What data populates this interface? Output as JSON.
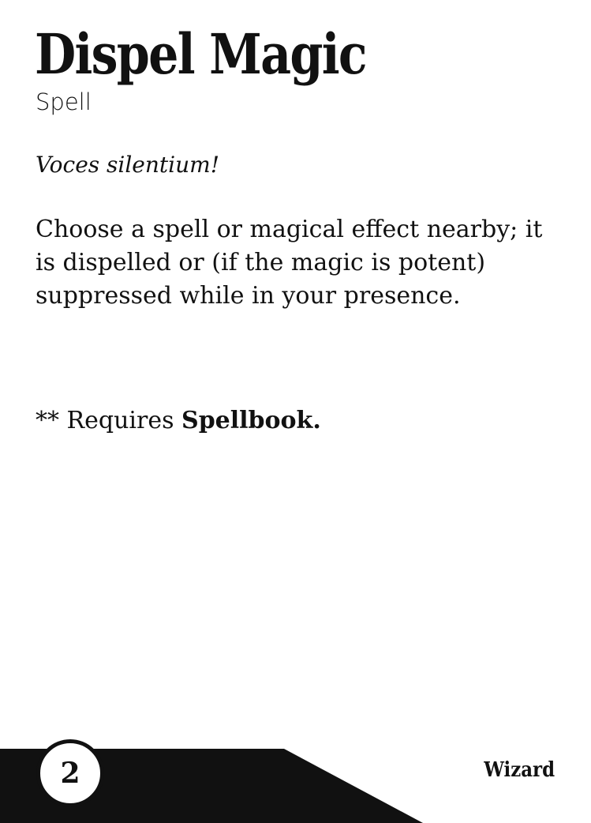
{
  "card": {
    "title": "Dispel Magic",
    "type": "Spell",
    "flavor": "Voces silentium!",
    "description": "Choose a spell or magical effect nearby; it is dispelled or (if the magic is potent) suppressed while in your presence.",
    "requires_prefix": "** Requires ",
    "requires_item": "Spellbook.",
    "level": "2",
    "class": "Wizard"
  },
  "colors": {
    "ink": "#111111",
    "background": "#ffffff"
  }
}
